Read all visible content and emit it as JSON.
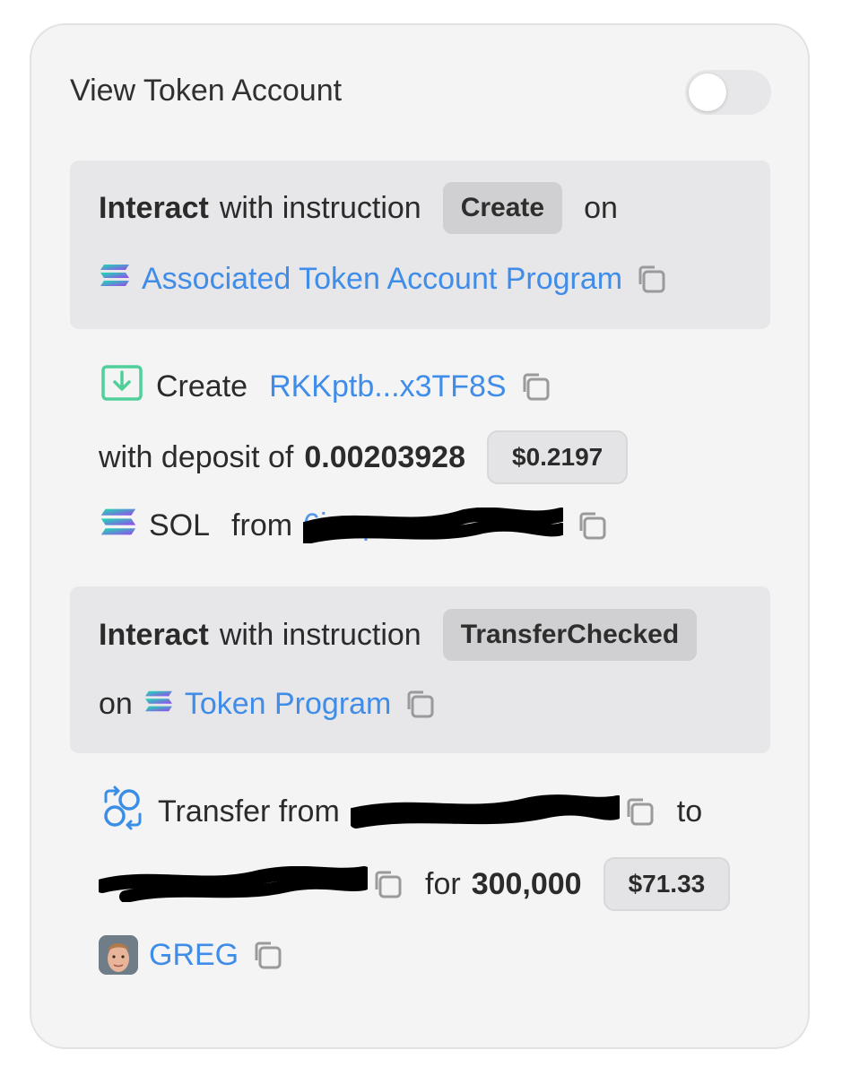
{
  "header": {
    "title": "View Token Account",
    "toggle_on": false
  },
  "instruction1": {
    "prefix_bold": "Interact",
    "prefix": "with instruction",
    "badge": "Create",
    "suffix": "on",
    "program": "Associated Token Account Program"
  },
  "create": {
    "verb": "Create",
    "account": "RKKptb...x3TF8S",
    "deposit_text": "with deposit of",
    "amount": "0.00203928",
    "usd": "$0.2197",
    "token": "SOL",
    "from": "from",
    "from_address_partial": "6j...q"
  },
  "instruction2": {
    "prefix_bold": "Interact",
    "prefix": "with instruction",
    "badge": "TransferChecked",
    "on": "on",
    "program": "Token Program"
  },
  "transfer": {
    "verb": "Transfer from",
    "to": "to",
    "for": "for",
    "amount": "300,000",
    "usd": "$71.33",
    "token": "GREG"
  },
  "colors": {
    "link": "#3f8de8",
    "create_icon": "#4fcf9a",
    "transfer_icon": "#3a8ee6",
    "card_bg": "#f4f4f5",
    "panel_bg": "#e7e7e9"
  },
  "icons": [
    "copy-icon",
    "solana-icon",
    "download-icon",
    "transfer-icon",
    "greg-token-avatar"
  ]
}
